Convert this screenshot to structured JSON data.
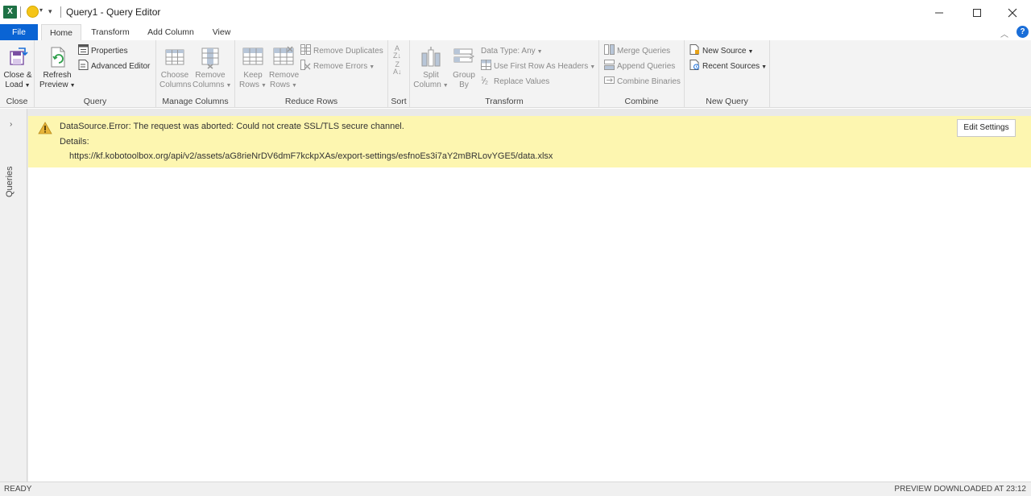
{
  "titlebar": {
    "excel_logo": "X",
    "title": "Query1 - Query Editor"
  },
  "menu": {
    "file": "File",
    "home": "Home",
    "transform": "Transform",
    "add_column": "Add Column",
    "view": "View"
  },
  "ribbon": {
    "close": {
      "close_load_1": "Close &",
      "close_load_2": "Load",
      "label": "Close"
    },
    "query": {
      "refresh_1": "Refresh",
      "refresh_2": "Preview",
      "properties": "Properties",
      "advanced_editor": "Advanced Editor",
      "label": "Query"
    },
    "manage_columns": {
      "choose_1": "Choose",
      "choose_2": "Columns",
      "remove_1": "Remove",
      "remove_2": "Columns",
      "label": "Manage Columns"
    },
    "reduce_rows": {
      "keep_1": "Keep",
      "keep_2": "Rows",
      "remove_1": "Remove",
      "remove_2": "Rows",
      "remove_duplicates": "Remove Duplicates",
      "remove_errors": "Remove Errors",
      "label": "Reduce Rows"
    },
    "sort": {
      "label": "Sort"
    },
    "transform": {
      "split_1": "Split",
      "split_2": "Column",
      "group_1": "Group",
      "group_2": "By",
      "data_type": "Data Type: Any",
      "first_row": "Use First Row As Headers",
      "replace_values": "Replace Values",
      "label": "Transform"
    },
    "combine": {
      "merge": "Merge Queries",
      "append": "Append Queries",
      "binaries": "Combine Binaries",
      "label": "Combine"
    },
    "new_query": {
      "new_source": "New Source",
      "recent_sources": "Recent Sources",
      "label": "New Query"
    }
  },
  "queries_pane": {
    "label": "Queries"
  },
  "error": {
    "message": "DataSource.Error: The request was aborted: Could not create SSL/TLS secure channel.",
    "details_label": "Details:",
    "url": "https://kf.kobotoolbox.org/api/v2/assets/aG8rieNrDV6dmF7kckpXAs/export-settings/esfnoEs3i7aY2mBRLovYGE5/data.xlsx",
    "edit_settings": "Edit Settings"
  },
  "status": {
    "left": "READY",
    "right": "PREVIEW DOWNLOADED AT 23:12"
  },
  "colors": {
    "file_tab": "#0a64d4",
    "error_bg": "#fdf6b0",
    "excel_green": "#1e7145",
    "help": "#1a6ed8"
  }
}
